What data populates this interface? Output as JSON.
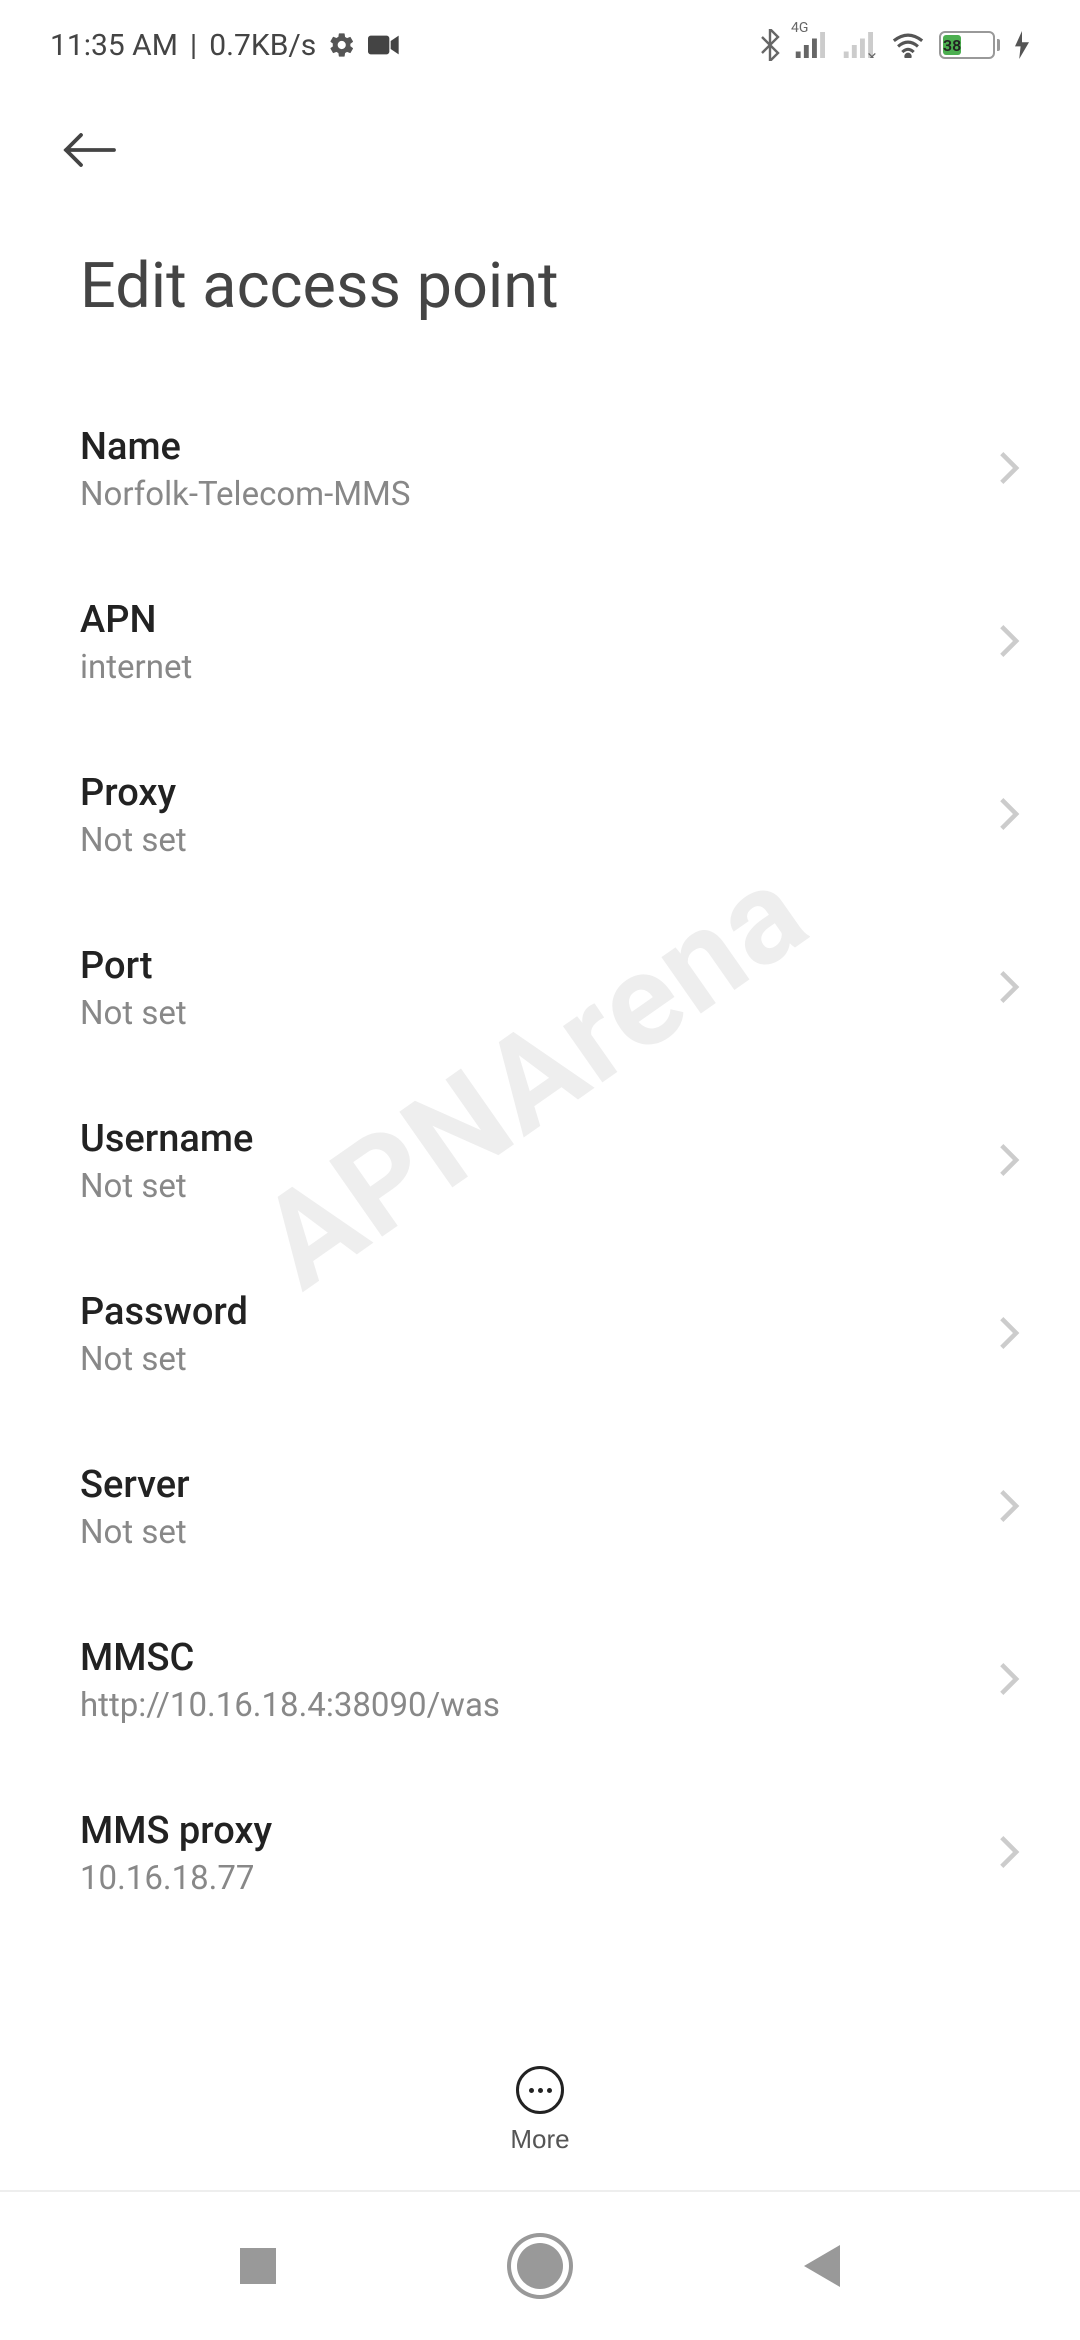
{
  "status_bar": {
    "time": "11:35 AM",
    "separator": "|",
    "data_rate": "0.7KB/s",
    "signal_label": "4G",
    "battery_level": "38"
  },
  "header": {
    "title": "Edit access point"
  },
  "settings": [
    {
      "label": "Name",
      "value": "Norfolk-Telecom-MMS"
    },
    {
      "label": "APN",
      "value": "internet"
    },
    {
      "label": "Proxy",
      "value": "Not set"
    },
    {
      "label": "Port",
      "value": "Not set"
    },
    {
      "label": "Username",
      "value": "Not set"
    },
    {
      "label": "Password",
      "value": "Not set"
    },
    {
      "label": "Server",
      "value": "Not set"
    },
    {
      "label": "MMSC",
      "value": "http://10.16.18.4:38090/was"
    },
    {
      "label": "MMS proxy",
      "value": "10.16.18.77"
    }
  ],
  "bottom": {
    "more_label": "More"
  },
  "watermark": "APNArena"
}
